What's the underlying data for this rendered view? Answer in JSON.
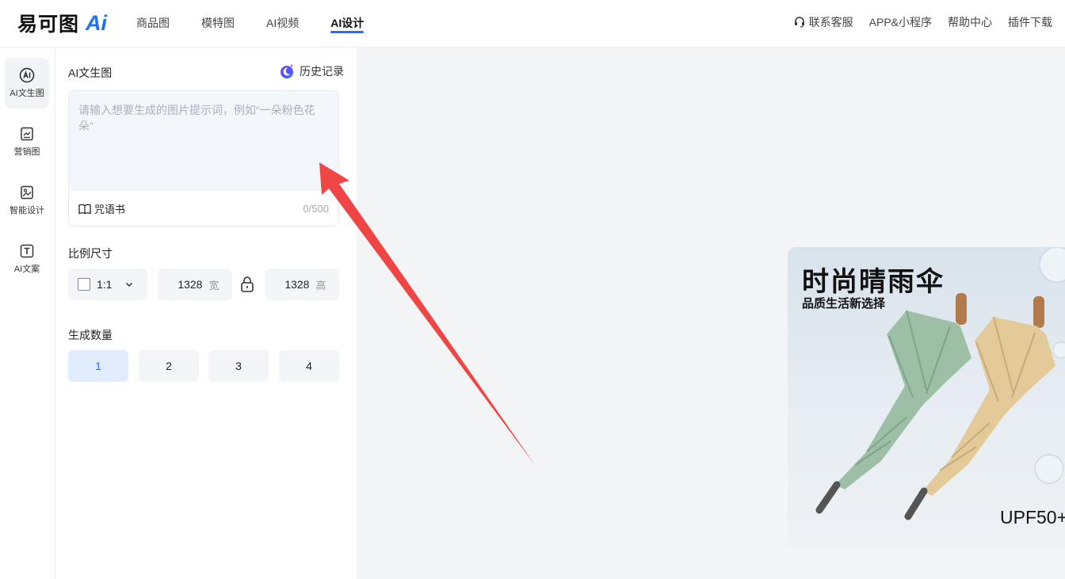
{
  "app": {
    "logo_text": "易可图",
    "logo_ai": "Ai"
  },
  "nav": [
    {
      "label": "商品图"
    },
    {
      "label": "模特图"
    },
    {
      "label": "AI视频"
    },
    {
      "label": "AI设计"
    }
  ],
  "header_links": {
    "support": "联系客服",
    "app": "APP&小程序",
    "help": "帮助中心",
    "plugin": "插件下载"
  },
  "sidebar": [
    {
      "label": "AI文生图",
      "icon": "ai-circle-icon"
    },
    {
      "label": "营销图",
      "icon": "marketing-image-icon"
    },
    {
      "label": "智能设计",
      "icon": "smart-design-icon"
    },
    {
      "label": "AI文案",
      "icon": "text-t-icon"
    }
  ],
  "panel": {
    "title": "AI文生图",
    "history_label": "历史记录",
    "prompt_placeholder": "请输入想要生成的图片提示词，例如“一朵粉色花朵”",
    "prompt_value": "",
    "spellbook_label": "咒语书",
    "counter": "0/500",
    "ratio_section_title": "比例尺寸",
    "ratio_value": "1:1",
    "width_value": "1328",
    "width_unit": "宽",
    "height_value": "1328",
    "height_unit": "高",
    "count_section_title": "生成数量",
    "count_options": [
      "1",
      "2",
      "3",
      "4"
    ],
    "count_selected": "1"
  },
  "poster": {
    "title": "时尚晴雨伞",
    "subtitle": "品质生活新选择",
    "badge": "UPF50+"
  },
  "colors": {
    "accent": "#2b6cff",
    "arrow": "#f04545",
    "canvas_bg": "#f3f4f6"
  }
}
